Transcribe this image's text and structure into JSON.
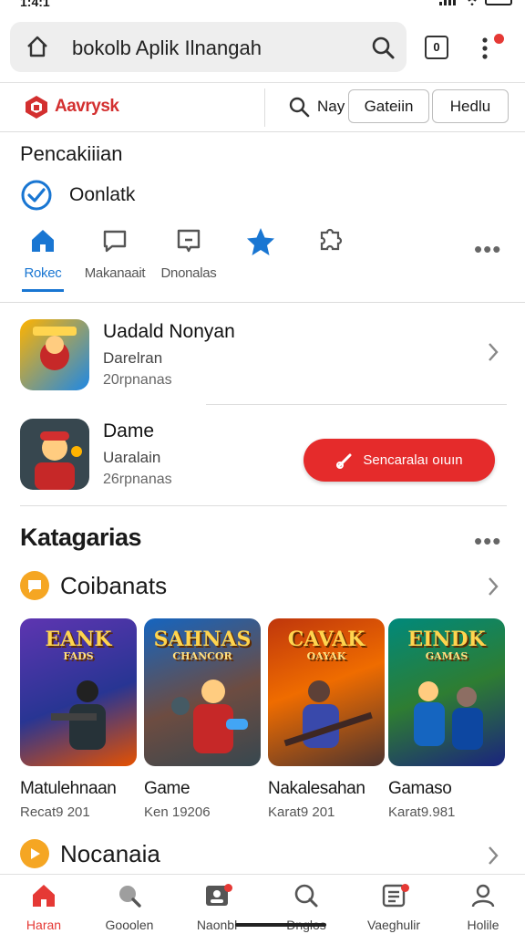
{
  "status_bar": {
    "time": "1:4:1"
  },
  "search": {
    "query": "bokolb Aplik Ilnangah",
    "tab_count": "0"
  },
  "store": {
    "brand": "Aavrysk",
    "search_label": "Nay",
    "get_label": "Gateiin",
    "help_label": "Hedlu"
  },
  "section": {
    "title": "Pencakiiian",
    "checked_label": "Oonlatk"
  },
  "tabs": [
    {
      "label": "Rokec",
      "icon": "home-icon",
      "active": true
    },
    {
      "label": "Makanaait",
      "icon": "chat-icon"
    },
    {
      "label": "Dnonalas",
      "icon": "message-icon"
    },
    {
      "label": "",
      "icon": "star-icon"
    },
    {
      "label": "",
      "icon": "puzzle-icon"
    }
  ],
  "apps": [
    {
      "title": "Uadald Nonyan",
      "subtitle": "Darelran",
      "meta": "20rpnanas"
    },
    {
      "title": "Dame",
      "subtitle": "Uaralain",
      "meta": "26rpnanas"
    }
  ],
  "install_button": {
    "label": "Sencaralaı oıuın"
  },
  "categories": {
    "title": "Katagarias",
    "group1": {
      "title": "Coibanats"
    },
    "group2": {
      "title": "Nocanaia"
    },
    "games": [
      {
        "title": "Matulehnaan",
        "meta": "Recat9 201",
        "logo": "EANK",
        "logo_sub": "FADS"
      },
      {
        "title": "Game",
        "meta": "Ken 19206",
        "logo": "SAHNAS",
        "logo_sub": "CHANCOR"
      },
      {
        "title": "Nakalesahan",
        "meta": "Karat9 201",
        "logo": "CAVAK",
        "logo_sub": "OAYAK"
      },
      {
        "title": "Gamaso",
        "meta": "Karat9.981",
        "logo": "EINDK",
        "logo_sub": "GAMAS"
      }
    ]
  },
  "bottom_nav": [
    {
      "label": "Haran",
      "icon": "home-icon",
      "active": true
    },
    {
      "label": "Gooolen",
      "icon": "search-icon"
    },
    {
      "label": "Naonbl",
      "icon": "id-card-icon"
    },
    {
      "label": "Dnglos",
      "icon": "search-icon"
    },
    {
      "label": "Vaeghulir",
      "icon": "list-icon"
    },
    {
      "label": "Holile",
      "icon": "profile-icon"
    }
  ],
  "colors": {
    "accent": "#1976d2",
    "brand": "#d32f2f",
    "install": "#e52b2b",
    "badge": "#f5a623"
  }
}
